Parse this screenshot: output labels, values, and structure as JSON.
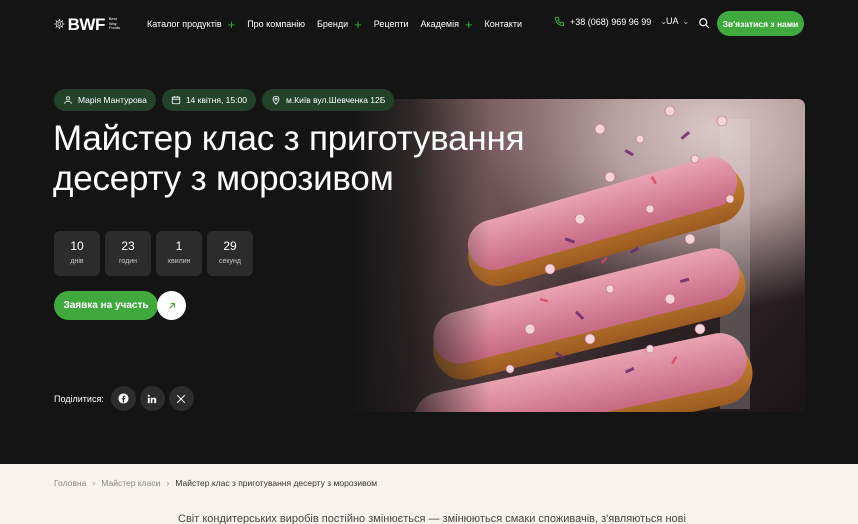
{
  "header": {
    "logo_text": "BWF",
    "logo_sub": [
      "Best",
      "Way",
      "Foods"
    ],
    "nav": [
      {
        "label": "Каталог продуктів",
        "has_plus": true
      },
      {
        "label": "Про компанію",
        "has_plus": false
      },
      {
        "label": "Бренди",
        "has_plus": true
      },
      {
        "label": "Рецепти",
        "has_plus": false
      },
      {
        "label": "Академія",
        "has_plus": true
      },
      {
        "label": "Контакти",
        "has_plus": false
      }
    ],
    "phone": "+38 (068) 969 96 99",
    "language": "UA",
    "contact_button": "Зв'язатися з нами"
  },
  "event": {
    "tags": {
      "author": "Марія Мантурова",
      "datetime": "14 квітня, 15:00",
      "location": "м.Київ вул.Шевченка 12Б"
    },
    "title_line1": "Майстер клас з приготування",
    "title_line2": "десерту з морозивом",
    "countdown": [
      {
        "value": "10",
        "unit": "днів"
      },
      {
        "value": "23",
        "unit": "годин"
      },
      {
        "value": "1",
        "unit": "хвилин"
      },
      {
        "value": "29",
        "unit": "секунд"
      }
    ],
    "apply_button": "Заявка на участь",
    "share_label": "Поділитися:",
    "share_icons": [
      "facebook-icon",
      "linkedin-icon",
      "x-icon"
    ]
  },
  "breadcrumbs": {
    "home": "Головна",
    "section": "Майстер класи",
    "current": "Майстер клас з приготування десерту з морозивом"
  },
  "intro_text": "Світ кондитерських виробів постійно змінюється — змінюються смаки споживачів, з'являються нові",
  "colors": {
    "accent": "#3fa93d",
    "background": "#141414",
    "tag_bg": "#22422a",
    "bottom_bg": "#f8f3ee"
  }
}
